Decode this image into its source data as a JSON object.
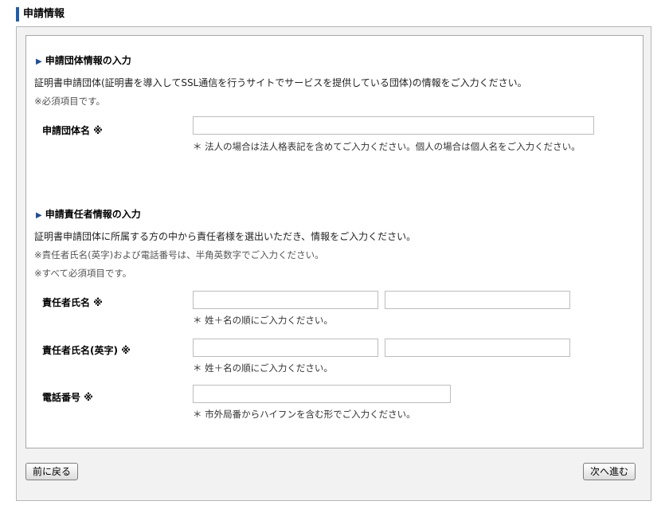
{
  "page_title": "申請情報",
  "section1": {
    "title": "申請団体情報の入力",
    "description": "証明書申請団体(証明書を導入してSSL通信を行うサイトでサービスを提供している団体)の情報をご入力ください。",
    "note": "※必須項目です。",
    "fields": {
      "org_name_label": "申請団体名 ※",
      "org_name_value": "",
      "org_name_hint": "＊ 法人の場合は法人格表記を含めてご入力ください。個人の場合は個人名をご入力ください。"
    }
  },
  "section2": {
    "title": "申請責任者情報の入力",
    "description": "証明書申請団体に所属する方の中から責任者様を選出いただき、情報をご入力ください。",
    "note1": "※責任者氏名(英字)および電話番号は、半角英数字でご入力ください。",
    "note2": "※すべて必須項目です。",
    "fields": {
      "name_label": "責任者氏名 ※",
      "name_last_value": "",
      "name_first_value": "",
      "name_hint": "＊ 姓＋名の順にご入力ください。",
      "name_en_label": "責任者氏名(英字) ※",
      "name_en_last_value": "",
      "name_en_first_value": "",
      "name_en_hint": "＊ 姓＋名の順にご入力ください。",
      "phone_label": "電話番号 ※",
      "phone_value": "",
      "phone_hint": "＊ 市外局番からハイフンを含む形でご入力ください。"
    }
  },
  "buttons": {
    "back": "前に戻る",
    "next": "次へ進む"
  }
}
